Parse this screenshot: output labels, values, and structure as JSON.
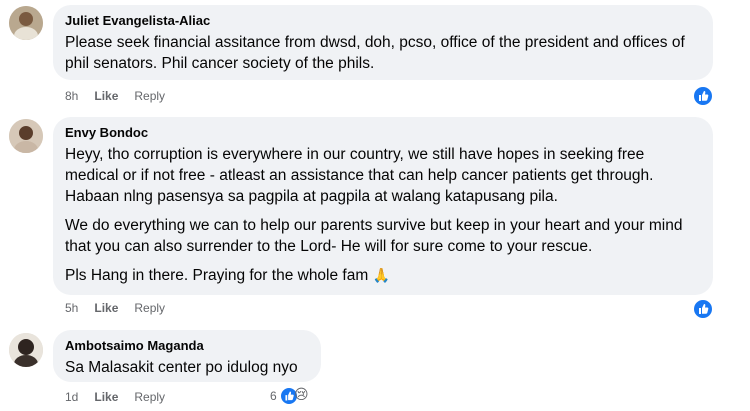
{
  "comments": [
    {
      "author": "Juliet Evangelista-Aliac",
      "paragraphs": [
        "Please seek financial assitance from dwsd, doh, pcso, office of the president and offices of phil senators. Phil cancer society of the phils."
      ],
      "time": "8h",
      "like": "Like",
      "reply": "Reply"
    },
    {
      "author": "Envy Bondoc",
      "paragraphs": [
        "Heyy, tho corruption is everywhere in our country, we still have hopes in seeking free medical or if not free - atleast an assistance that can help cancer patients get through. Habaan nlng pasensya sa pagpila at pagpila at walang katapusang pila.",
        "We do everything we can to help our parents survive but keep in your heart and your mind that you can also surrender to the Lord- He will for sure come to your rescue.",
        "Pls Hang in there. Praying for the whole fam"
      ],
      "praying_emoji": "🙏",
      "time": "5h",
      "like": "Like",
      "reply": "Reply"
    },
    {
      "author": "Ambotsaimo Maganda",
      "paragraphs": [
        "Sa Malasakit center po idulog nyo"
      ],
      "time": "1d",
      "like": "Like",
      "reply": "Reply",
      "reaction_count": "6",
      "sad_emoji": "😢"
    }
  ],
  "colors": {
    "bubble": "#f0f2f5",
    "like_blue": "#1877f2",
    "meta_gray": "#65676b"
  }
}
